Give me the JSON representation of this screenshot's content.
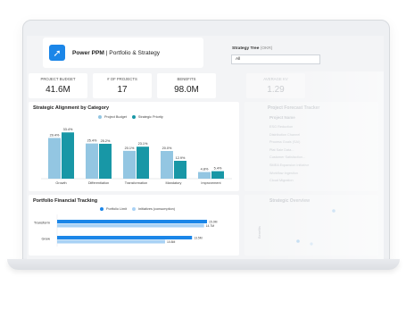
{
  "app": {
    "title_bold": "Power PPM",
    "title_rest": " | Portfolio & Strategy",
    "logo_icon": "rocket-icon",
    "accent_color": "#1b86e8"
  },
  "filter": {
    "label": "Strategy Tree",
    "label_hint": "(OKR)",
    "value": "All"
  },
  "kpis": [
    {
      "label": "PROJECT BUDGET",
      "value": "41.6M"
    },
    {
      "label": "# OF PROJECTS",
      "value": "17"
    },
    {
      "label": "BENEFITS",
      "value": "98.0M"
    },
    {
      "label": "AVERAGE KV",
      "value": "1.29"
    }
  ],
  "alignment": {
    "title": "Strategic Alignment by Category",
    "legend": [
      "Project Budget",
      "Strategic Priority"
    ]
  },
  "tracking": {
    "title": "Portfolio Financial Tracking",
    "legend": [
      "Portfolio Limit",
      "Initiatives (consumption)"
    ]
  },
  "right": {
    "forecast_title": "Project Forecast Tracker",
    "column_header": "Project Name",
    "rows": [
      "ESG Reduction",
      "Distribution Channel",
      "Process Goals (SAI)",
      "Plat Sale Data...",
      "Customer Satisfaction...",
      "SMEA Expansion Initiative",
      "Workflow Ingestion",
      "Cloud Migration"
    ],
    "overview_title": "Strategic Overview",
    "axis_label": "Benefits"
  },
  "chart_data": [
    {
      "type": "bar",
      "title": "Strategic Alignment by Category",
      "categories": [
        "Growth",
        "Differentiation",
        "Transformation",
        "Mandatory",
        "Improvement"
      ],
      "series": [
        {
          "name": "Project Budget",
          "color": "#93c6e2",
          "values": [
            29.4,
            25.4,
            20.1,
            20.0,
            4.8
          ],
          "labels": [
            "29.4%",
            "25.4%",
            "20.1%",
            "20.0%",
            "4.8%"
          ]
        },
        {
          "name": "Strategic Priority",
          "color": "#1897a6",
          "values": [
            33.4,
            25.2,
            23.1,
            12.9,
            5.4
          ],
          "labels": [
            "33.4%",
            "25.2%",
            "23.1%",
            "12.9%",
            "5.4%"
          ]
        }
      ],
      "ylim": [
        0,
        40
      ]
    },
    {
      "type": "bar",
      "orientation": "horizontal",
      "title": "Portfolio Financial Tracking",
      "categories": [
        "Transform",
        "Grow"
      ],
      "series": [
        {
          "name": "Portfolio Limit",
          "color": "#1b86e8",
          "values": [
            15.0,
            13.5
          ],
          "labels": [
            "15.0M",
            "13.5M"
          ]
        },
        {
          "name": "Initiatives (consumption)",
          "color": "#a9d2f5",
          "values": [
            14.7,
            10.8
          ],
          "labels": [
            "14.7M",
            "10.8M"
          ]
        }
      ],
      "xlim": [
        0,
        15
      ]
    }
  ]
}
